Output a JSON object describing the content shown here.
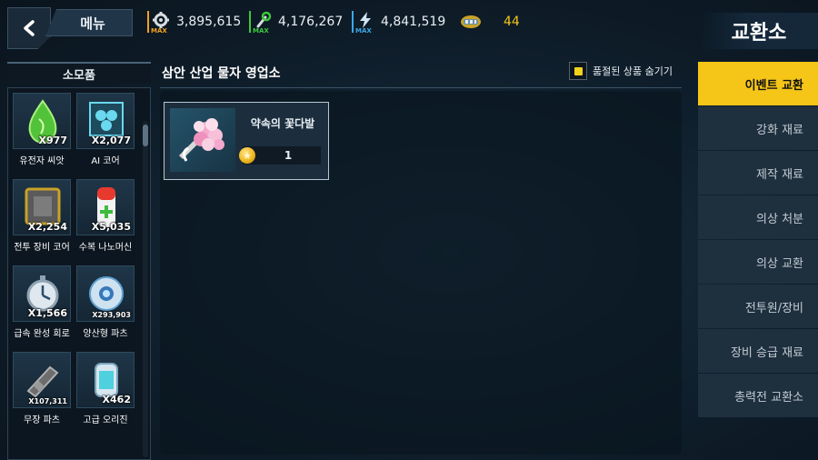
{
  "header": {
    "menu_label": "메뉴",
    "title": "교환소",
    "resources": [
      {
        "icon": "gear-icon",
        "value": "3,895,615",
        "badge": "MAX",
        "color": "#f0a020"
      },
      {
        "icon": "wrench-icon",
        "value": "4,176,267",
        "badge": "MAX",
        "color": "#3cc83c"
      },
      {
        "icon": "lightning-icon",
        "value": "4,841,519",
        "badge": "MAX",
        "color": "#3aa8e8"
      },
      {
        "icon": "ticket-icon",
        "value": "44",
        "color": "#f5c518"
      }
    ]
  },
  "sidebar": {
    "header": "소모품",
    "items": [
      {
        "name": "유전자 씨앗",
        "count": "X977",
        "icon": "seed-icon"
      },
      {
        "name": "AI 코어",
        "count": "X2,077",
        "icon": "ai-core-icon"
      },
      {
        "name": "전투 장비 코어",
        "count": "X2,254",
        "icon": "equipment-core-icon"
      },
      {
        "name": "수복 나노머신",
        "count": "X5,035",
        "icon": "nanomachine-icon"
      },
      {
        "name": "급속 완성 회로",
        "count": "X1,566",
        "icon": "stopwatch-icon"
      },
      {
        "name": "양산형 파츠",
        "count": "X293,903",
        "icon": "parts-orb-icon"
      },
      {
        "name": "무장 파츠",
        "count": "X107,311",
        "icon": "weapon-parts-icon"
      },
      {
        "name": "고급 오리진",
        "count": "X462",
        "icon": "origin-icon"
      }
    ]
  },
  "shop": {
    "title": "삼안 산업 물자 영업소",
    "hide_sold_out_label": "품절된 상품 숨기기",
    "items": [
      {
        "name": "약속의 꽃다발",
        "price": "1",
        "icon": "bouquet-icon",
        "currency_icon": "coin-icon"
      }
    ]
  },
  "nav": {
    "items": [
      {
        "label": "이벤트 교환",
        "active": true
      },
      {
        "label": "강화 재료"
      },
      {
        "label": "제작 재료"
      },
      {
        "label": "의상 처분"
      },
      {
        "label": "의상 교환"
      },
      {
        "label": "전투원/장비"
      },
      {
        "label": "장비 승급 재료"
      },
      {
        "label": "총력전 교환소"
      }
    ]
  },
  "colors": {
    "accent": "#f5c518",
    "panel": "#1e2f3e"
  }
}
